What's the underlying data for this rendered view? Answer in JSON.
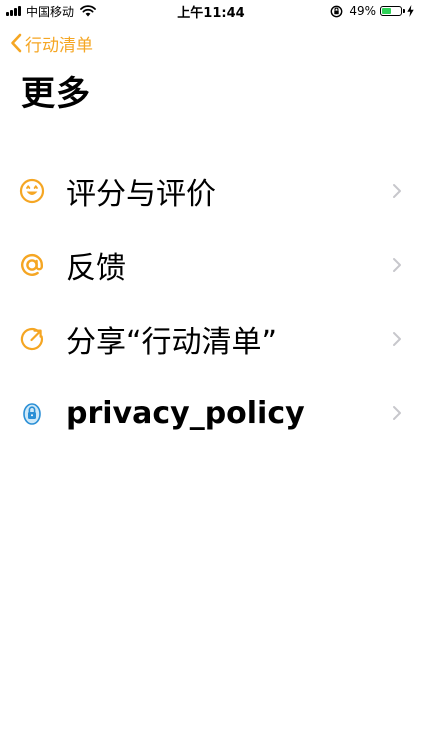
{
  "status_bar": {
    "carrier": "中国移动",
    "time": "上午11:44",
    "battery_percent": "49%",
    "battery_level": 0.49,
    "battery_color": "#2fd158"
  },
  "nav": {
    "back_label": "行动清单",
    "accent_color": "#f5a623"
  },
  "page": {
    "title": "更多"
  },
  "menu": {
    "items": [
      {
        "icon": "smiley-icon",
        "label": "评分与评价"
      },
      {
        "icon": "at-sign-icon",
        "label": "反馈"
      },
      {
        "icon": "share-icon",
        "label": "分享“行动清单”"
      },
      {
        "icon": "privacy-lock-icon",
        "label": "privacy_policy"
      }
    ]
  }
}
